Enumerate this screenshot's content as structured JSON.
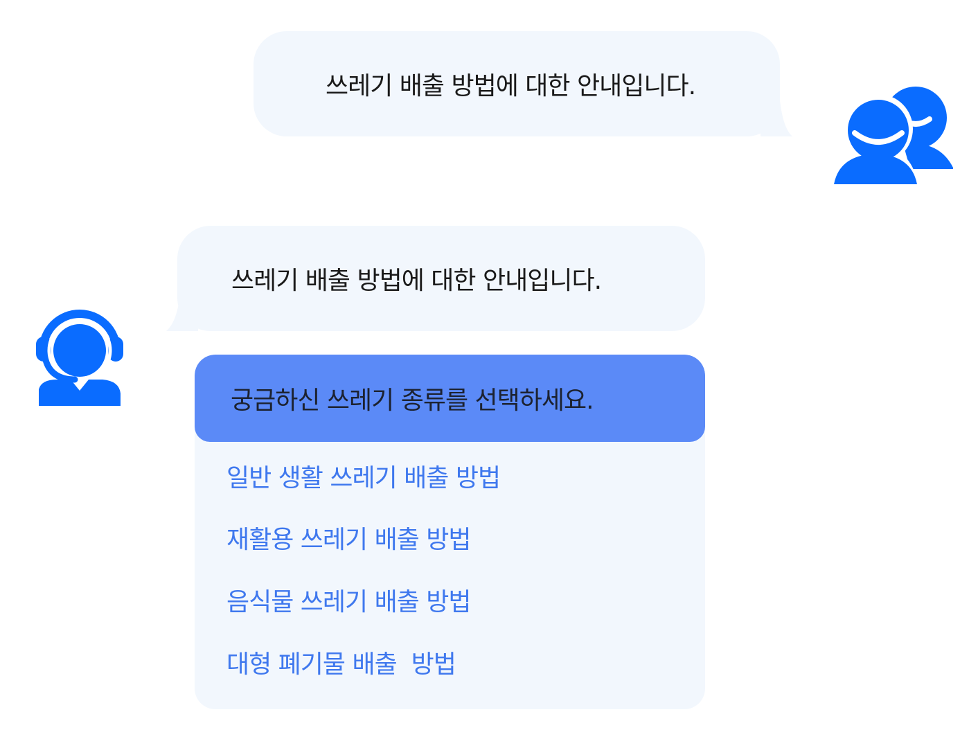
{
  "user_message": {
    "text": "쓰레기 배출 방법에 대한 안내입니다.",
    "avatar_icon": "users-icon"
  },
  "bot_message": {
    "text": "쓰레기 배출 방법에 대한 안내입니다.",
    "avatar_icon": "headset-agent-icon"
  },
  "menu": {
    "title": "궁금하신 쓰레기 종류를 선택하세요.",
    "items": [
      {
        "label": "일반 생활 쓰레기 배출 방법"
      },
      {
        "label": "재활용 쓰레기 배출 방법"
      },
      {
        "label": "음식물 쓰레기 배출 방법"
      },
      {
        "label": "대형 폐기물 배출  방법"
      }
    ]
  },
  "colors": {
    "accent": "#0a6cff",
    "menu_header": "#5b8af7",
    "menu_link": "#3f78ee",
    "bubble_bg": "#f2f7fd"
  }
}
